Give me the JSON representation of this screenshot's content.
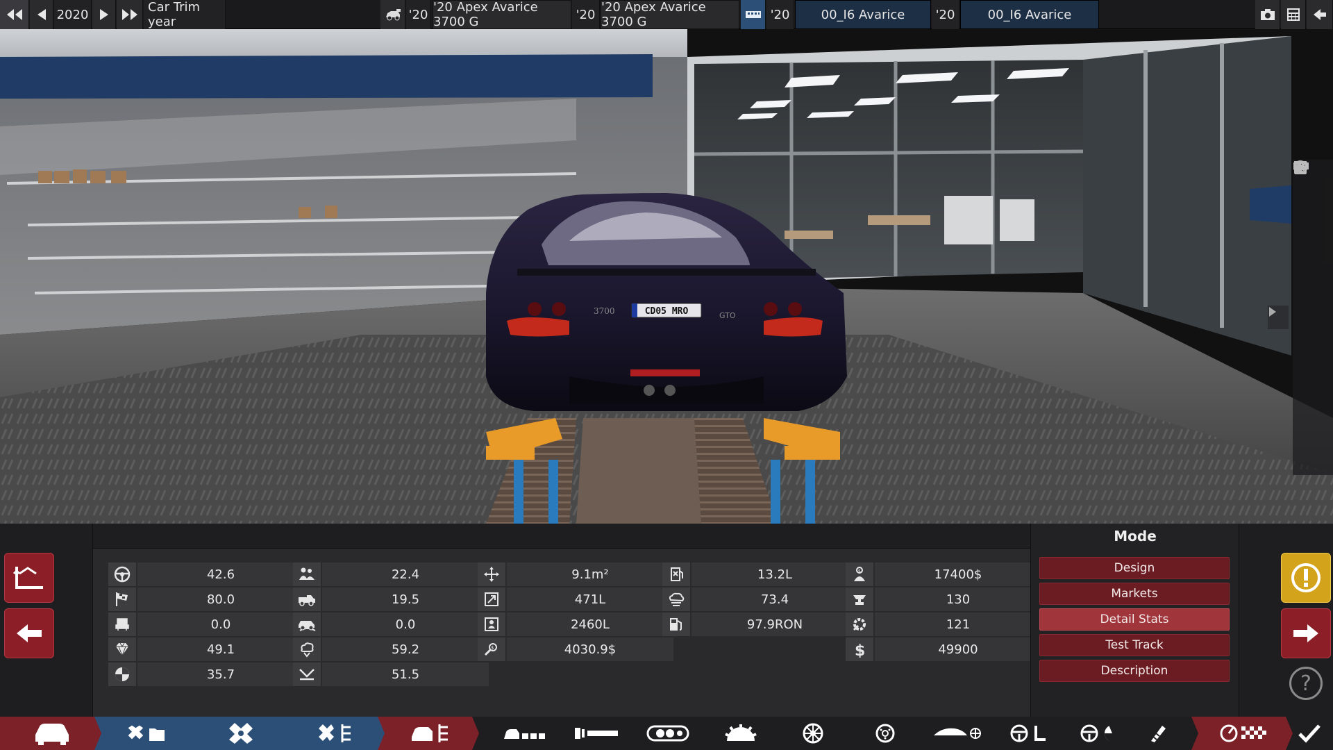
{
  "topbar": {
    "year": "2020",
    "trim_label": "Car Trim year",
    "model_year": "'20",
    "model_name": "'20 Apex Avarice 3700 G",
    "trim_year": "'20",
    "trim_name": "'20 Apex Avarice 3700 G",
    "engine_year": "'20",
    "engine_name": "00_I6 Avarice",
    "variant_year": "'20",
    "variant_name": "00_I6 Avarice"
  },
  "car": {
    "plate": "CD05 MRO",
    "badge_left": "3700",
    "badge_right": "GTO"
  },
  "stats": {
    "col1": [
      "42.6",
      "80.0",
      "0.0",
      "49.1",
      "35.7"
    ],
    "col2": [
      "22.4",
      "19.5",
      "0.0",
      "59.2",
      "51.5"
    ],
    "col3": [
      "9.1m²",
      "471L",
      "2460L",
      "4030.9$"
    ],
    "col4": [
      "13.2L",
      "73.4",
      "97.9RON"
    ],
    "col5": [
      "17400$",
      "130",
      "121",
      "49900"
    ]
  },
  "mode": {
    "title": "Mode",
    "buttons": [
      "Design",
      "Markets",
      "Detail Stats",
      "Test Track",
      "Description"
    ],
    "active": "Detail Stats"
  },
  "help": "?",
  "colors": {
    "accent_red": "#8b1e26",
    "active_red": "#a0353c",
    "nav_blue": "#2c4f78",
    "nav_red": "#7c2128",
    "warning_yellow": "#d4a31c"
  }
}
